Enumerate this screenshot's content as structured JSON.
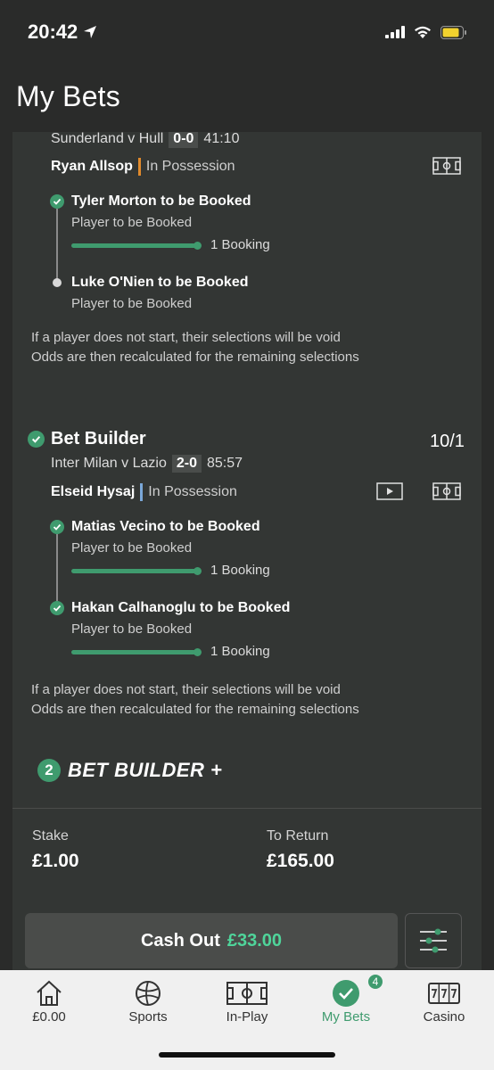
{
  "status_bar": {
    "time": "20:42"
  },
  "header": {
    "title": "My Bets"
  },
  "bet1": {
    "match": "Sunderland v Hull",
    "score": "0-0",
    "clock": "41:10",
    "player": "Ryan Allsop",
    "possession": "In Possession",
    "possession_color": "#e08a2c",
    "selections": [
      {
        "title": "Tyler Morton to be Booked",
        "sub": "Player to be Booked",
        "progress_label": "1 Booking",
        "progress": 1.0,
        "settled": true
      },
      {
        "title": "Luke O'Nien to be Booked",
        "sub": "Player to be Booked",
        "settled": false
      }
    ],
    "info_line1": "If a player does not start, their selections will be void",
    "info_line2": "Odds are then recalculated for the remaining selections"
  },
  "bet2": {
    "type": "Bet Builder",
    "odds": "10/1",
    "match": "Inter Milan v Lazio",
    "score": "2-0",
    "clock": "85:57",
    "player": "Elseid Hysaj",
    "possession": "In Possession",
    "possession_color": "#7aa7d8",
    "selections": [
      {
        "title": "Matias Vecino to be Booked",
        "sub": "Player to be Booked",
        "progress_label": "1 Booking",
        "progress": 1.0,
        "settled": true
      },
      {
        "title": "Hakan Calhanoglu to be Booked",
        "sub": "Player to be Booked",
        "progress_label": "1 Booking",
        "progress": 1.0,
        "settled": true
      }
    ],
    "info_line1": "If a player does not start, their selections will be void",
    "info_line2": "Odds are then recalculated for the remaining selections"
  },
  "bet_builder_plus": {
    "count": "2",
    "label": "BET BUILDER +"
  },
  "stake": {
    "stake_label": "Stake",
    "stake_value": "£1.00",
    "return_label": "To Return",
    "return_value": "£165.00"
  },
  "cashout": {
    "label": "Cash Out",
    "amount": "£33.00"
  },
  "tabs": [
    {
      "label": "£0.00",
      "icon": "home-icon"
    },
    {
      "label": "Sports",
      "icon": "football-icon"
    },
    {
      "label": "In-Play",
      "icon": "pitch-icon"
    },
    {
      "label": "My Bets",
      "icon": "check-circle-icon",
      "badge": "4",
      "active": true
    },
    {
      "label": "Casino",
      "icon": "slot-machine-icon"
    }
  ],
  "colors": {
    "accent": "#3f9b6e",
    "cashout_amount": "#4fd49a",
    "background": "#2a2b2a",
    "card": "#333634"
  }
}
